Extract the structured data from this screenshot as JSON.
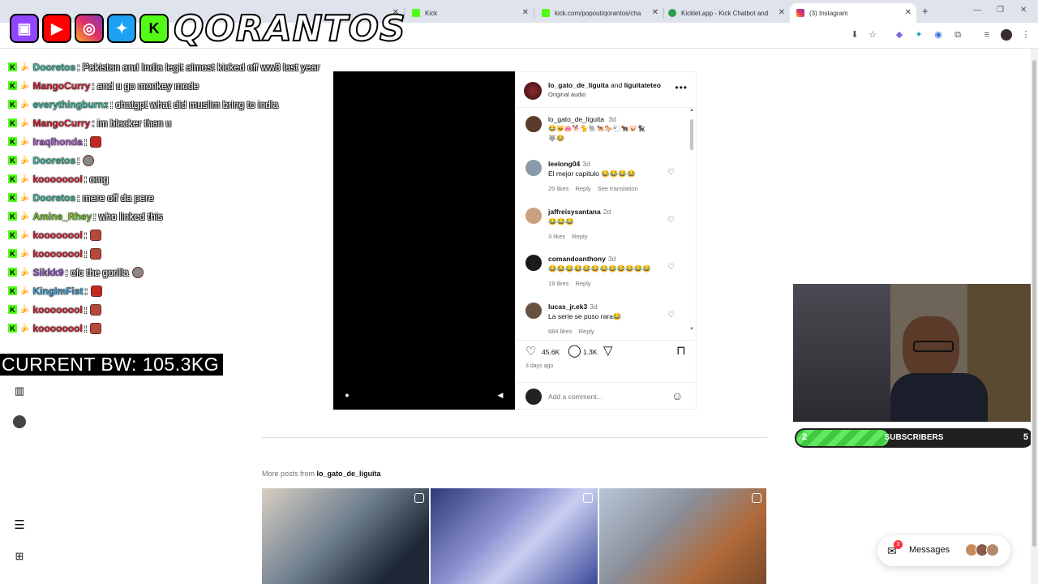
{
  "browser": {
    "tabs": [
      {
        "label": "",
        "icon": "blank-tab-icon"
      },
      {
        "label": "Kick",
        "icon": "kick-icon"
      },
      {
        "label": "kick.com/popout/qorantos/cha",
        "icon": "kick-icon"
      },
      {
        "label": "Kicklet.app - Kick Chatbot and",
        "icon": "kicklet-icon"
      },
      {
        "label": "(3) Instagram",
        "icon": "instagram-icon"
      }
    ],
    "new_tab": "+"
  },
  "overlay": {
    "brand": "QORANTOS",
    "bodyweight": "CURRENT BW: 105.3KG",
    "chat": [
      {
        "user": "Dooretos",
        "color": "#3fc7a8",
        "msg": ": Pakistan and India legit almost kicked off ww3 last year",
        "emote": ""
      },
      {
        "user": "MangoCurry",
        "color": "#e8243a",
        "msg": ": and u go monkey mode",
        "emote": ""
      },
      {
        "user": "everythingburnz",
        "color": "#3fc7a8",
        "msg": ": chatgpt what did muslim bring to india",
        "emote": ""
      },
      {
        "user": "MangoCurry",
        "color": "#e8243a",
        "msg": ": im blacker than u",
        "emote": ""
      },
      {
        "user": "Iraqlhonda",
        "color": "#b25ee0",
        "msg": ":",
        "emote": "red"
      },
      {
        "user": "Dooretos",
        "color": "#3fc7a8",
        "msg": ":",
        "emote": "gray"
      },
      {
        "user": "koooooool",
        "color": "#e8243a",
        "msg": ": omg",
        "emote": ""
      },
      {
        "user": "Dooretos",
        "color": "#3fc7a8",
        "msg": ": mere off da pere",
        "emote": ""
      },
      {
        "user": "Amine_Rhey",
        "color": "#7ed321",
        "msg": ": who linked this",
        "emote": ""
      },
      {
        "user": "koooooool",
        "color": "#e8243a",
        "msg": ":",
        "emote": "brown"
      },
      {
        "user": "koooooool",
        "color": "#e8243a",
        "msg": ":",
        "emote": "brown"
      },
      {
        "user": "Sikkk9",
        "color": "#9b59d0",
        "msg": ": ofc the gorilla",
        "emote": "gray"
      },
      {
        "user": "KingImFist",
        "color": "#3aa6e0",
        "msg": ":",
        "emote": "red"
      },
      {
        "user": "koooooool",
        "color": "#e8243a",
        "msg": ":",
        "emote": "brown"
      },
      {
        "user": "koooooool",
        "color": "#e8243a",
        "msg": ":",
        "emote": "brown"
      }
    ],
    "subs": {
      "current": "2",
      "label": "SUBSCRIBERS",
      "goal": "5",
      "progress": 0.4
    }
  },
  "post": {
    "header_user1": "lo_gato_de_liguita",
    "header_and": "and",
    "header_user2": "liguitateteo",
    "header_sub": "Original audio",
    "caption_user": "lo_gato_de_liguita",
    "caption_time": "3d",
    "caption_text": "😂🐱🐽🐕🐈🐘🐕‍🦺🐎🐑🐂🐷🐈‍⬛",
    "caption_text2": "🐺😂",
    "comments": [
      {
        "user": "leelong04",
        "time": "3d",
        "text": "El mejor capitulo 😂😂😂😂",
        "likes": "25 likes",
        "reply": "Reply",
        "extra": "See translation"
      },
      {
        "user": "jaffreisysantana",
        "time": "2d",
        "text": "😂😂😂",
        "likes": "3 likes",
        "reply": "Reply",
        "extra": ""
      },
      {
        "user": "comandoanthony",
        "time": "3d",
        "text": "😂😂😂😂😂😂😂😂😂😂😂😂",
        "likes": "19 likes",
        "reply": "Reply",
        "extra": ""
      },
      {
        "user": "lucas_jr.ek3",
        "time": "3d",
        "text": "La serie se puso rara😂",
        "likes": "684 likes",
        "reply": "Reply",
        "extra": ""
      }
    ],
    "like_count": "45.6K",
    "comment_count": "1.3K",
    "posted": "3 days ago",
    "add_comment_placeholder": "Add a comment..."
  },
  "more_posts": {
    "prefix": "More posts from",
    "user": "lo_gato_de_liguita"
  },
  "messages": {
    "label": "Messages",
    "badge": "3"
  }
}
